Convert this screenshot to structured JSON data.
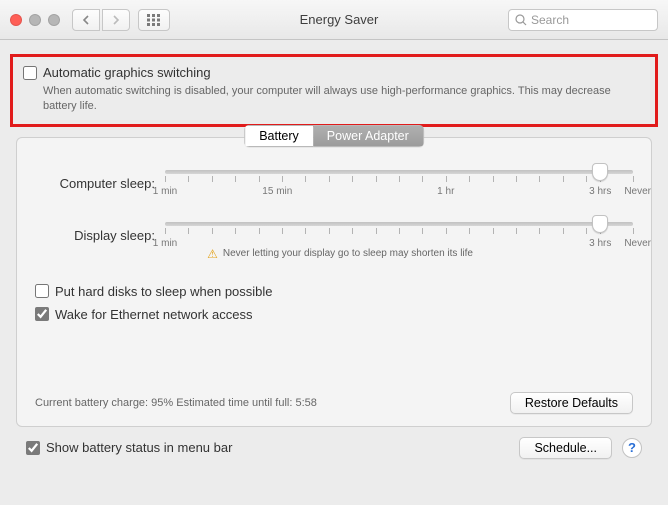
{
  "window": {
    "title": "Energy Saver",
    "search_placeholder": "Search"
  },
  "graphics": {
    "checkbox_label": "Automatic graphics switching",
    "desc": "When automatic switching is disabled, your computer will always use high-performance graphics. This may decrease battery life.",
    "checked": false
  },
  "tabs": {
    "active": "Battery",
    "inactive": "Power Adapter"
  },
  "sliders": {
    "computer_label": "Computer sleep:",
    "display_label": "Display sleep:",
    "ticks": {
      "min": "1 min",
      "t1": "15 min",
      "t2": "1 hr",
      "maxhrs": "3 hrs",
      "never": "Never"
    },
    "display_warning": "Never letting your display go to sleep may shorten its life"
  },
  "options": {
    "hd_sleep": "Put hard disks to sleep when possible",
    "wake_ethernet": "Wake for Ethernet network access"
  },
  "status": {
    "text": "Current battery charge: 95%  Estimated time until full: 5:58",
    "restore_btn": "Restore Defaults"
  },
  "footer": {
    "menu_bar_label": "Show battery status in menu bar",
    "schedule_btn": "Schedule..."
  }
}
